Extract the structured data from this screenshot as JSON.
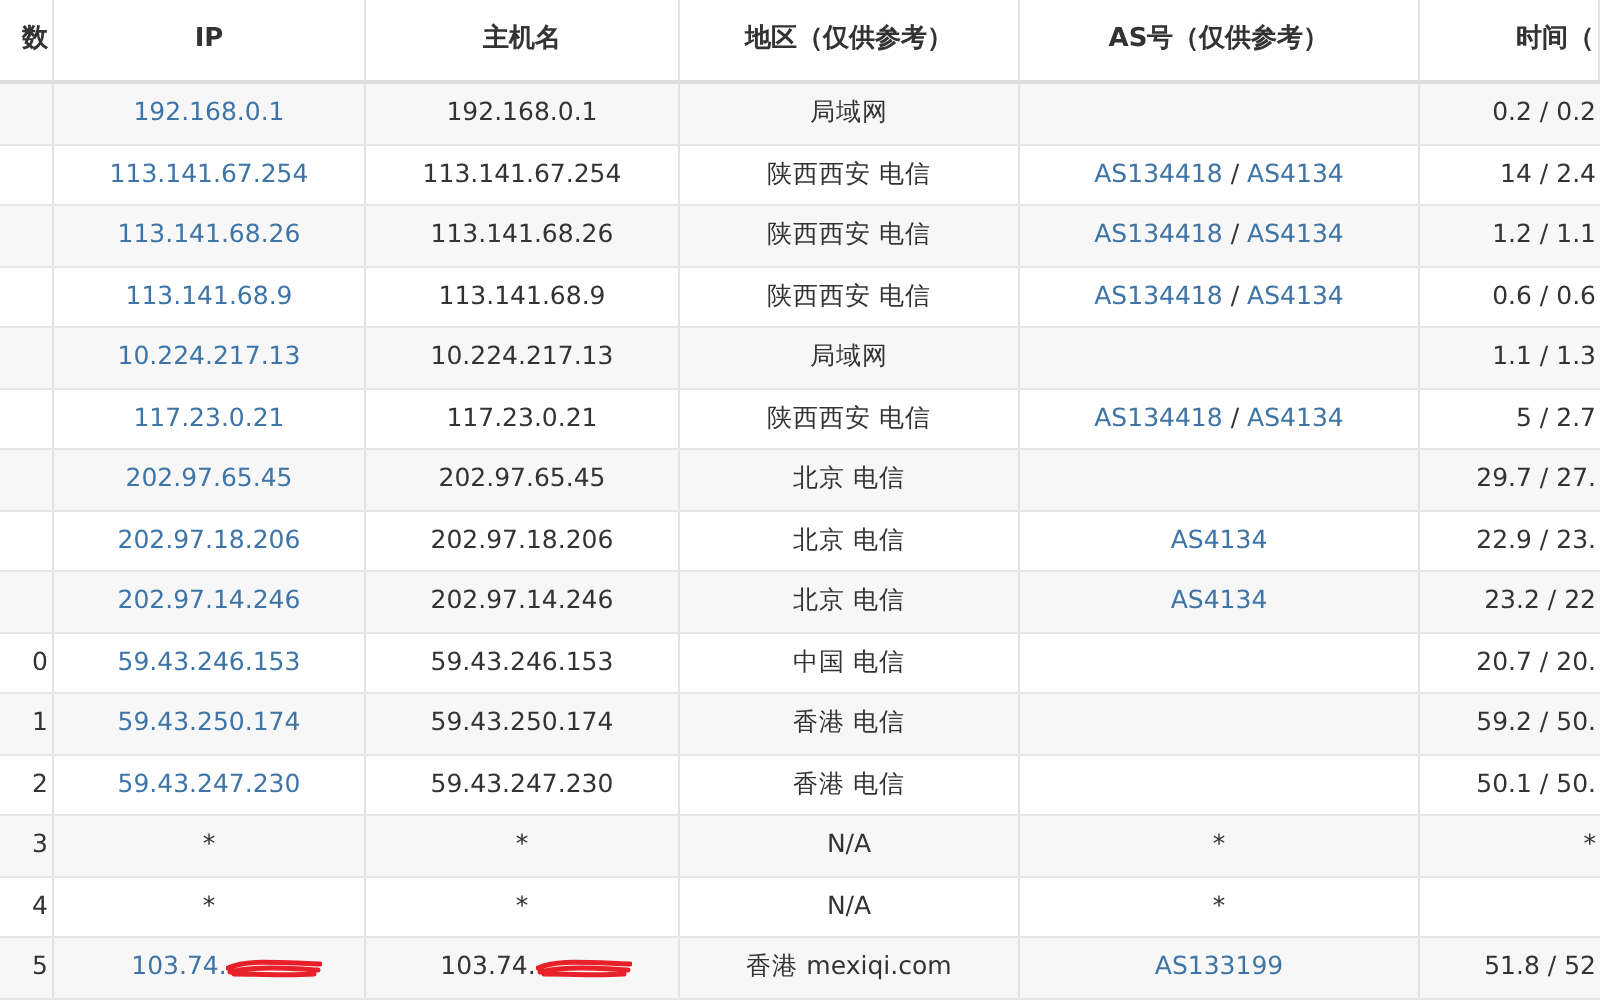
{
  "table": {
    "columns": [
      "数",
      "IP",
      "主机名",
      "地区（仅供参考）",
      "AS号（仅供参考）",
      "时间（"
    ],
    "rows": [
      {
        "hop": "",
        "ip": "192.168.0.1",
        "host": "192.168.0.1",
        "region": "局域网",
        "as": [],
        "time": "0.2 / 0.2"
      },
      {
        "hop": "",
        "ip": "113.141.67.254",
        "host": "113.141.67.254",
        "region": "陕西西安 电信",
        "as": [
          {
            "kind": "link",
            "text": "AS134418"
          },
          {
            "kind": "separator",
            "text": "/"
          },
          {
            "kind": "link",
            "text": "AS4134"
          }
        ],
        "time": "14 / 2.4"
      },
      {
        "hop": "",
        "ip": "113.141.68.26",
        "host": "113.141.68.26",
        "region": "陕西西安 电信",
        "as": [
          {
            "kind": "link",
            "text": "AS134418"
          },
          {
            "kind": "separator",
            "text": "/"
          },
          {
            "kind": "link",
            "text": "AS4134"
          }
        ],
        "time": "1.2 / 1.1"
      },
      {
        "hop": "",
        "ip": "113.141.68.9",
        "host": "113.141.68.9",
        "region": "陕西西安 电信",
        "as": [
          {
            "kind": "link",
            "text": "AS134418"
          },
          {
            "kind": "separator",
            "text": "/"
          },
          {
            "kind": "link",
            "text": "AS4134"
          }
        ],
        "time": "0.6 / 0.6"
      },
      {
        "hop": "",
        "ip": "10.224.217.13",
        "host": "10.224.217.13",
        "region": "局域网",
        "as": [],
        "time": "1.1 / 1.3"
      },
      {
        "hop": "",
        "ip": "117.23.0.21",
        "host": "117.23.0.21",
        "region": "陕西西安 电信",
        "as": [
          {
            "kind": "link",
            "text": "AS134418"
          },
          {
            "kind": "separator",
            "text": "/"
          },
          {
            "kind": "link",
            "text": "AS4134"
          }
        ],
        "time": "5 / 2.7"
      },
      {
        "hop": "",
        "ip": "202.97.65.45",
        "host": "202.97.65.45",
        "region": "北京 电信",
        "as": [],
        "time": "29.7 / 27."
      },
      {
        "hop": "",
        "ip": "202.97.18.206",
        "host": "202.97.18.206",
        "region": "北京 电信",
        "as": [
          {
            "kind": "link",
            "text": "AS4134"
          }
        ],
        "time": "22.9 / 23."
      },
      {
        "hop": "",
        "ip": "202.97.14.246",
        "host": "202.97.14.246",
        "region": "北京 电信",
        "as": [
          {
            "kind": "link",
            "text": "AS4134"
          }
        ],
        "time": "23.2 / 22"
      },
      {
        "hop": "0",
        "ip": "59.43.246.153",
        "host": "59.43.246.153",
        "region": "中国 电信",
        "as": [],
        "time": "20.7 / 20."
      },
      {
        "hop": "1",
        "ip": "59.43.250.174",
        "host": "59.43.250.174",
        "region": "香港 电信",
        "as": [],
        "time": "59.2 / 50."
      },
      {
        "hop": "2",
        "ip": "59.43.247.230",
        "host": "59.43.247.230",
        "region": "香港 电信",
        "as": [],
        "time": "50.1 / 50."
      },
      {
        "hop": "3",
        "ip": "*",
        "host": "*",
        "region": "N/A",
        "as_text": "*",
        "time": "*"
      },
      {
        "hop": "4",
        "ip": "*",
        "host": "*",
        "region": "N/A",
        "as_text": "*",
        "time": ""
      },
      {
        "hop": "5",
        "ip": "103.74.",
        "host": "103.74.",
        "region": "香港 mexiqi.com",
        "as": [
          {
            "kind": "link",
            "text": "AS133199"
          }
        ],
        "time": "51.8 / 52",
        "redacted": true
      }
    ]
  }
}
